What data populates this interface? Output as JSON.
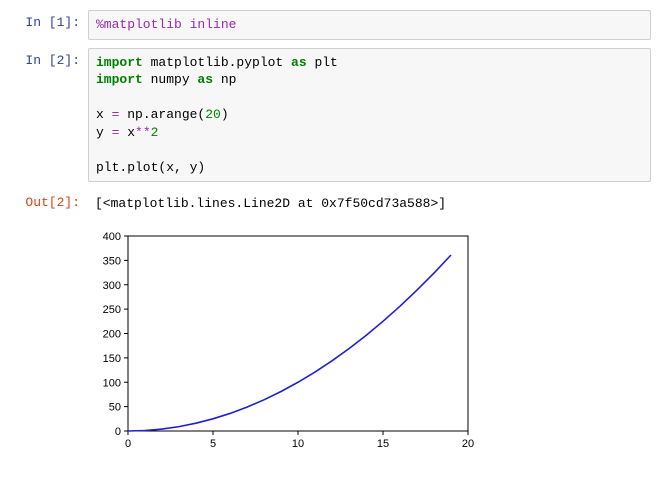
{
  "cells": [
    {
      "prompt": "In [1]:",
      "magic": "%matplotlib inline"
    },
    {
      "prompt": "In [2]:",
      "line1_kw1": "import",
      "line1_mod": " matplotlib.pyplot ",
      "line1_kw2": "as",
      "line1_alias": " plt",
      "line2_kw1": "import",
      "line2_mod": " numpy ",
      "line2_kw2": "as",
      "line2_alias": " np",
      "line3_pre": "x ",
      "line3_op": "=",
      "line3_mid": " np.arange(",
      "line3_num": "20",
      "line3_post": ")",
      "line4_pre": "y ",
      "line4_op": "=",
      "line4_mid": " x",
      "line4_pow": "**",
      "line4_num": "2",
      "line5": "plt.plot(x, y)"
    },
    {
      "prompt": "Out[2]:",
      "text": "[<matplotlib.lines.Line2D at 0x7f50cd73a588>]"
    }
  ],
  "chart_data": {
    "type": "line",
    "x": [
      0,
      1,
      2,
      3,
      4,
      5,
      6,
      7,
      8,
      9,
      10,
      11,
      12,
      13,
      14,
      15,
      16,
      17,
      18,
      19
    ],
    "y": [
      0,
      1,
      4,
      9,
      16,
      25,
      36,
      49,
      64,
      81,
      100,
      121,
      144,
      169,
      196,
      225,
      256,
      289,
      324,
      361
    ],
    "xlim": [
      0,
      20
    ],
    "ylim": [
      0,
      400
    ],
    "xticks": [
      0,
      5,
      10,
      15,
      20
    ],
    "yticks": [
      0,
      50,
      100,
      150,
      200,
      250,
      300,
      350,
      400
    ],
    "title": "",
    "xlabel": "",
    "ylabel": "",
    "line_color": "#1f1fd6"
  }
}
